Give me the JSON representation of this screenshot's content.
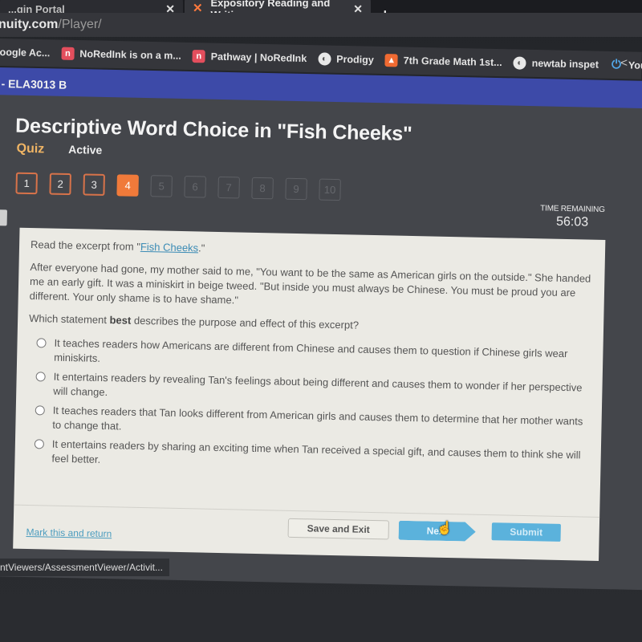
{
  "browser": {
    "tabs": [
      {
        "label": "...gin Portal",
        "active": false
      },
      {
        "label": "Expository Reading and Writing",
        "active": true
      }
    ],
    "new_tab_label": "+",
    "url_host": "nuity.com",
    "url_path": "/Player/",
    "bookmarks": [
      {
        "label": "oogle Ac...",
        "icon": "none"
      },
      {
        "label": "NoRedInk is on a m...",
        "icon": "noredink-icon"
      },
      {
        "label": "Pathway | NoRedInk",
        "icon": "noredink-icon"
      },
      {
        "label": "Prodigy",
        "icon": "globe-icon"
      },
      {
        "label": "7th Grade Math 1st...",
        "icon": "classroom-icon"
      },
      {
        "label": "newtab inspet",
        "icon": "globe-icon"
      },
      {
        "label": "YourForum -> Arc",
        "icon": "power-icon"
      }
    ],
    "status_url": "ntViewers/AssessmentViewer/Activit..."
  },
  "course": {
    "name": "- ELA3013 B"
  },
  "activity": {
    "title": "Descriptive Word Choice in \"Fish Cheeks\"",
    "type": "Quiz",
    "status": "Active",
    "questions": [
      {
        "number": "1",
        "state": "answered"
      },
      {
        "number": "2",
        "state": "answered"
      },
      {
        "number": "3",
        "state": "answered"
      },
      {
        "number": "4",
        "state": "current"
      },
      {
        "number": "5",
        "state": "locked"
      },
      {
        "number": "6",
        "state": "locked"
      },
      {
        "number": "7",
        "state": "locked"
      },
      {
        "number": "8",
        "state": "locked"
      },
      {
        "number": "9",
        "state": "locked"
      },
      {
        "number": "10",
        "state": "locked"
      }
    ],
    "timer": {
      "label": "TIME REMAINING",
      "value": "56:03"
    }
  },
  "question": {
    "intro_prefix": "Read the excerpt from \"",
    "intro_link": "Fish Cheeks",
    "intro_suffix": ".\"",
    "passage": "After everyone had gone, my mother said to me, \"You want to be the same as American girls on the outside.\" She handed me an early gift. It was a miniskirt in beige tweed. \"But inside you must always be Chinese. You must be proud you are different. Your only shame is to have shame.\"",
    "prompt_prefix": "Which statement ",
    "prompt_bold": "best",
    "prompt_suffix": " describes the purpose and effect of this excerpt?",
    "options": [
      "It teaches readers how Americans are different from Chinese and causes them to question if Chinese girls wear miniskirts.",
      "It entertains readers by revealing Tan's feelings about being different and causes them to wonder if her perspective will change.",
      "It teaches readers that Tan looks different from American girls and causes them to determine that her mother wants to change that.",
      "It entertains readers by sharing an exciting time when Tan received a special gift, and causes them to think she will feel better."
    ]
  },
  "footer": {
    "mark_link": "Mark this and return",
    "save_exit": "Save and Exit",
    "next": "Next",
    "submit": "Submit"
  },
  "colors": {
    "course_bar": "#3d4aa8",
    "current_question": "#f07a3a",
    "quiz_label": "#f0b565",
    "primary_button": "#5bb2dc",
    "link": "#3b8bb5"
  }
}
